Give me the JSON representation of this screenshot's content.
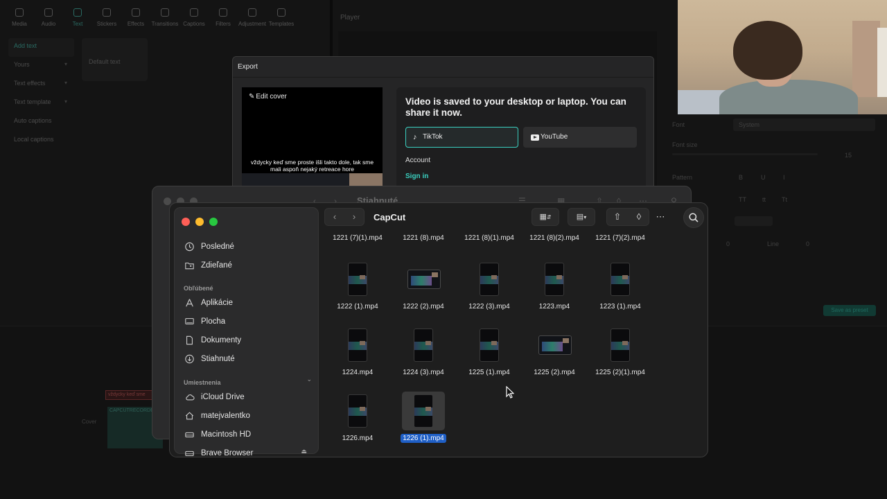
{
  "capcut": {
    "toolbar": [
      "Media",
      "Audio",
      "Text",
      "Stickers",
      "Effects",
      "Transitions",
      "Captions",
      "Filters",
      "Adjustment",
      "Templates"
    ],
    "left_menu": [
      {
        "label": "Add text",
        "chevron": false
      },
      {
        "label": "Yours",
        "chevron": true
      },
      {
        "label": "Text effects",
        "chevron": true
      },
      {
        "label": "Text template",
        "chevron": true
      },
      {
        "label": "Auto captions",
        "chevron": false
      },
      {
        "label": "Local captions",
        "chevron": false
      }
    ],
    "default_text": "Default text",
    "player_label": "Player",
    "right_panel": {
      "font_label": "Font",
      "font_value": "System",
      "font_size_label": "Font size",
      "font_size_value": "15",
      "pattern_label": "Pattern",
      "case_options": [
        "TT",
        "tt",
        "Tt"
      ],
      "spacing_value": "0",
      "line_label": "Line",
      "line_value": "0",
      "save_preset": "Save as preset"
    },
    "timeline": {
      "clip_text": "vždycky keď sme",
      "clip_video": "CAPCUTRECORDER",
      "cover_label": "Cover"
    }
  },
  "export": {
    "title": "Export",
    "edit_cover": "Edit cover",
    "subtitle": "vždycky keď sme proste išli takto dole, tak sme mali aspoň nejaký retreace hore",
    "saved_message": "Video is saved to your desktop or laptop. You can share it now.",
    "share": [
      {
        "label": "TikTok",
        "icon": "tiktok-icon",
        "selected": true
      },
      {
        "label": "YouTube",
        "icon": "youtube-icon",
        "selected": false
      }
    ],
    "account_label": "Account",
    "sign_in": "Sign in",
    "accent_color": "#3ad0c0"
  },
  "finder_back": {
    "title": "Stiahnuté"
  },
  "finder": {
    "title": "CapCut",
    "sidebar": {
      "top_items": [
        {
          "label": "Posledné",
          "icon": "clock-icon"
        },
        {
          "label": "Zdieľané",
          "icon": "shared-folder-icon"
        }
      ],
      "favorites_heading": "Obľúbené",
      "favorites": [
        {
          "label": "Aplikácie",
          "icon": "applications-icon"
        },
        {
          "label": "Plocha",
          "icon": "desktop-icon"
        },
        {
          "label": "Dokumenty",
          "icon": "document-icon"
        },
        {
          "label": "Stiahnuté",
          "icon": "download-icon"
        }
      ],
      "locations_heading": "Umiestnenia",
      "locations": [
        {
          "label": "iCloud Drive",
          "icon": "cloud-icon"
        },
        {
          "label": "matejvalentko",
          "icon": "home-icon"
        },
        {
          "label": "Macintosh HD",
          "icon": "disk-icon"
        },
        {
          "label": "Brave Browser",
          "icon": "disk-icon"
        }
      ]
    },
    "top_row_labels": [
      "1221 (7)(1).mp4",
      "1221 (8).mp4",
      "1221 (8)(1).mp4",
      "1221 (8)(2).mp4",
      "1221 (7)(2).mp4"
    ],
    "files": [
      {
        "name": "1222 (1).mp4",
        "orientation": "portrait",
        "selected": false
      },
      {
        "name": "1222 (2).mp4",
        "orientation": "landscape",
        "selected": false
      },
      {
        "name": "1222 (3).mp4",
        "orientation": "portrait",
        "selected": false
      },
      {
        "name": "1223.mp4",
        "orientation": "portrait",
        "selected": false
      },
      {
        "name": "1223 (1).mp4",
        "orientation": "portrait",
        "selected": false
      },
      {
        "name": "1224.mp4",
        "orientation": "portrait",
        "selected": false
      },
      {
        "name": "1224 (3).mp4",
        "orientation": "portrait",
        "selected": false
      },
      {
        "name": "1225 (1).mp4",
        "orientation": "portrait",
        "selected": false
      },
      {
        "name": "1225 (2).mp4",
        "orientation": "landscape",
        "selected": false
      },
      {
        "name": "1225 (2)(1).mp4",
        "orientation": "portrait",
        "selected": false
      },
      {
        "name": "1226.mp4",
        "orientation": "portrait",
        "selected": false
      },
      {
        "name": "1226 (1).mp4",
        "orientation": "portrait",
        "selected": true
      }
    ],
    "selection_color": "#1f5fc6"
  }
}
